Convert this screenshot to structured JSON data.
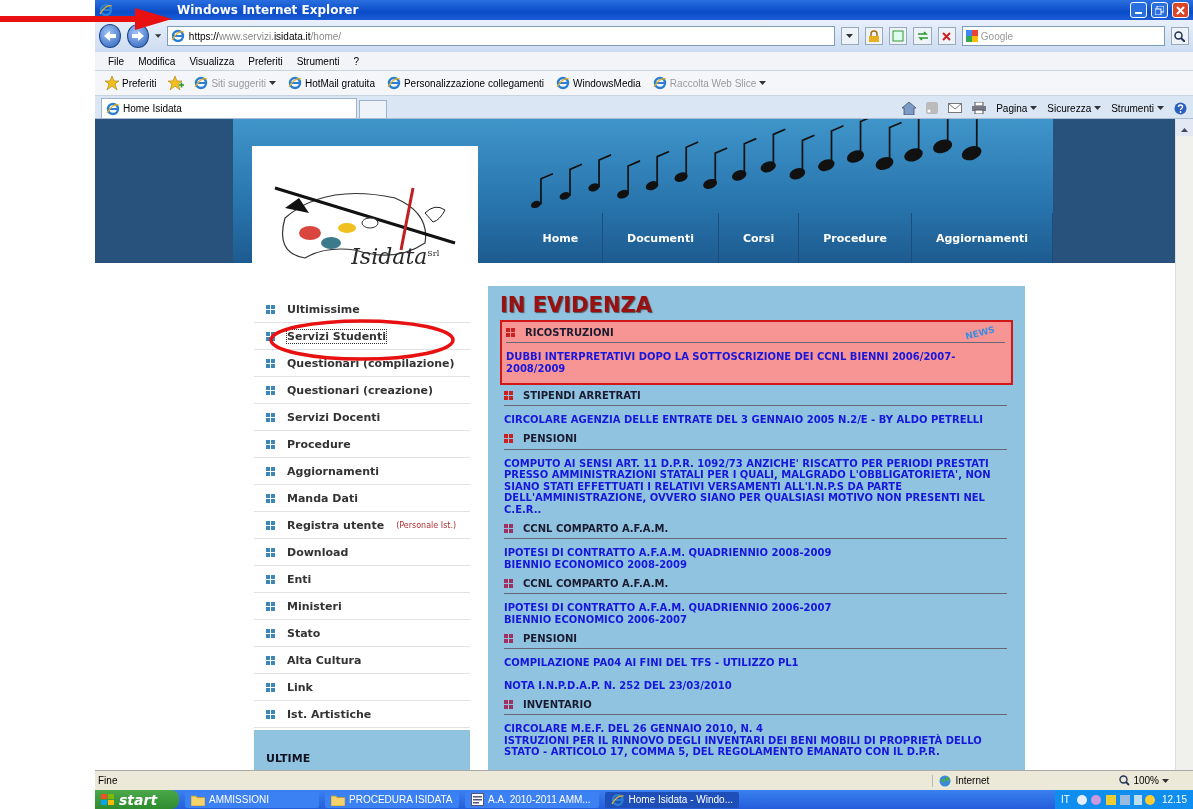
{
  "window": {
    "title": "Windows Internet Explorer"
  },
  "address_bar": {
    "url_parts": [
      {
        "text": "https://",
        "emphasized": true
      },
      {
        "text": "www.servizi.",
        "emphasized": false
      },
      {
        "text": "isidata.it",
        "emphasized": true
      },
      {
        "text": "/home/",
        "emphasized": false
      }
    ]
  },
  "search_field": {
    "placeholder": "Google"
  },
  "menu_bar": [
    "File",
    "Modifica",
    "Visualizza",
    "Preferiti",
    "Strumenti",
    "?"
  ],
  "favorites_bar": {
    "favorites": "Preferiti",
    "links": [
      {
        "label": "Siti suggeriti",
        "disabled": true,
        "dropdown": true
      },
      {
        "label": "HotMail gratuita",
        "disabled": false,
        "dropdown": false
      },
      {
        "label": "Personalizzazione collegamenti",
        "disabled": false,
        "dropdown": false
      },
      {
        "label": "WindowsMedia",
        "disabled": false,
        "dropdown": false
      },
      {
        "label": "Raccolta Web Slice",
        "disabled": true,
        "dropdown": true
      }
    ]
  },
  "tabs": [
    {
      "label": "Home Isidata",
      "selected": true
    }
  ],
  "command_bar": [
    "Pagina",
    "Sicurezza",
    "Strumenti"
  ],
  "site": {
    "logo": {
      "text": "Isidata",
      "suffix": "Srl"
    },
    "nav": [
      "Home",
      "Documenti",
      "Corsi",
      "Procedure",
      "Aggiornamenti"
    ],
    "sidebar": [
      {
        "label": "Ultimissime",
        "focused": false
      },
      {
        "label": "Servizi Studenti",
        "focused": true
      },
      {
        "label": "Questionari (compilazione)",
        "focused": false
      },
      {
        "label": "Questionari (creazione)",
        "focused": false
      },
      {
        "label": "Servizi Docenti",
        "focused": false
      },
      {
        "label": "Procedure",
        "focused": false
      },
      {
        "label": "Aggiornamenti",
        "focused": false
      },
      {
        "label": "Manda Dati",
        "focused": false
      },
      {
        "label": "Registra utente",
        "note": "(Personale Ist.)",
        "focused": false
      },
      {
        "label": "Download",
        "focused": false
      },
      {
        "label": "Enti",
        "focused": false
      },
      {
        "label": "Ministeri",
        "focused": false
      },
      {
        "label": "Stato",
        "focused": false
      },
      {
        "label": "Alta Cultura",
        "focused": false
      },
      {
        "label": "Link",
        "focused": false
      },
      {
        "label": "Ist. Artistiche",
        "focused": false
      }
    ],
    "ultime_box": {
      "title": "ULTIME"
    },
    "news_panel": {
      "title": "IN EVIDENZA",
      "badge": "NEWS",
      "sections": [
        {
          "heading": "RICOSTRUZIONI",
          "highlighted": true,
          "items": [
            {
              "lines": [
                "DUBBI INTERPRETATIVI DOPO LA SOTTOSCRIZIONE DEI CCNL BIENNI 2006/2007-2008/2009"
              ]
            }
          ]
        },
        {
          "heading": "STIPENDI ARRETRATI",
          "highlighted": false,
          "items": [
            {
              "lines": [
                "CIRCOLARE AGENZIA DELLE ENTRATE DEL 3 GENNAIO 2005 N.2/E - BY ALDO PETRELLI"
              ]
            }
          ]
        },
        {
          "heading": "PENSIONI",
          "highlighted": false,
          "items": [
            {
              "lines": [
                "COMPUTO AI SENSI ART. 11 D.P.R. 1092/73 ANZICHE' RISCATTO PER PERIODI PRESTATI PRESSO AMMINISTRAZIONI STATALI PER I QUALI, MALGRADO L'OBBLIGATORIETA', NON SIANO STATI EFFETTUATI I RELATIVI VERSAMENTI ALL'I.N.P.S DA PARTE DELL'AMMINISTRAZIONE, OVVERO SIANO PER QUALSIASI MOTIVO NON PRESENTI NEL C.E.R.."
              ]
            }
          ]
        },
        {
          "heading": "CCNL COMPARTO A.F.A.M.",
          "highlighted": false,
          "items": [
            {
              "lines": [
                "IPOTESI DI CONTRATTO A.F.A.M. QUADRIENNIO 2008-2009",
                "BIENNIO ECONOMICO 2008-2009"
              ]
            }
          ]
        },
        {
          "heading": "CCNL COMPARTO A.F.A.M.",
          "highlighted": false,
          "items": [
            {
              "lines": [
                "IPOTESI DI CONTRATTO A.F.A.M. QUADRIENNIO 2006-2007",
                "BIENNIO ECONOMICO 2006-2007"
              ]
            }
          ]
        },
        {
          "heading": "PENSIONI",
          "highlighted": false,
          "items": [
            {
              "lines": [
                "COMPILAZIONE PA04 AI FINI DEL TFS - UTILIZZO PL1"
              ]
            },
            {
              "lines": [
                "NOTA I.N.P.D.A.P. N. 252 DEL 23/03/2010"
              ]
            }
          ]
        },
        {
          "heading": "INVENTARIO",
          "highlighted": false,
          "items": [
            {
              "lines": [
                "CIRCOLARE M.E.F. DEL 26 GENNAIO 2010, N. 4",
                "ISTRUZIONI PER IL RINNOVO DEGLI INVENTARI DEI BENI MOBILI DI PROPRIETÀ DELLO STATO - ARTICOLO 17, COMMA 5, DEL REGOLAMENTO EMANATO CON IL D.P.R."
              ]
            }
          ]
        }
      ]
    }
  },
  "status_bar": {
    "text": "Fine",
    "zone": "Internet",
    "zoom": "100%"
  },
  "taskbar": {
    "start": "start",
    "items": [
      {
        "label": "AMMISSIONI",
        "kind": "folder",
        "selected": false
      },
      {
        "label": "PROCEDURA ISIDATA",
        "kind": "folder",
        "selected": false
      },
      {
        "label": "A.A. 2010-2011 AMM...",
        "kind": "document",
        "selected": false
      },
      {
        "label": "Home Isidata - Windo...",
        "kind": "browser",
        "selected": true
      }
    ],
    "language": "IT",
    "clock": "12.15"
  }
}
